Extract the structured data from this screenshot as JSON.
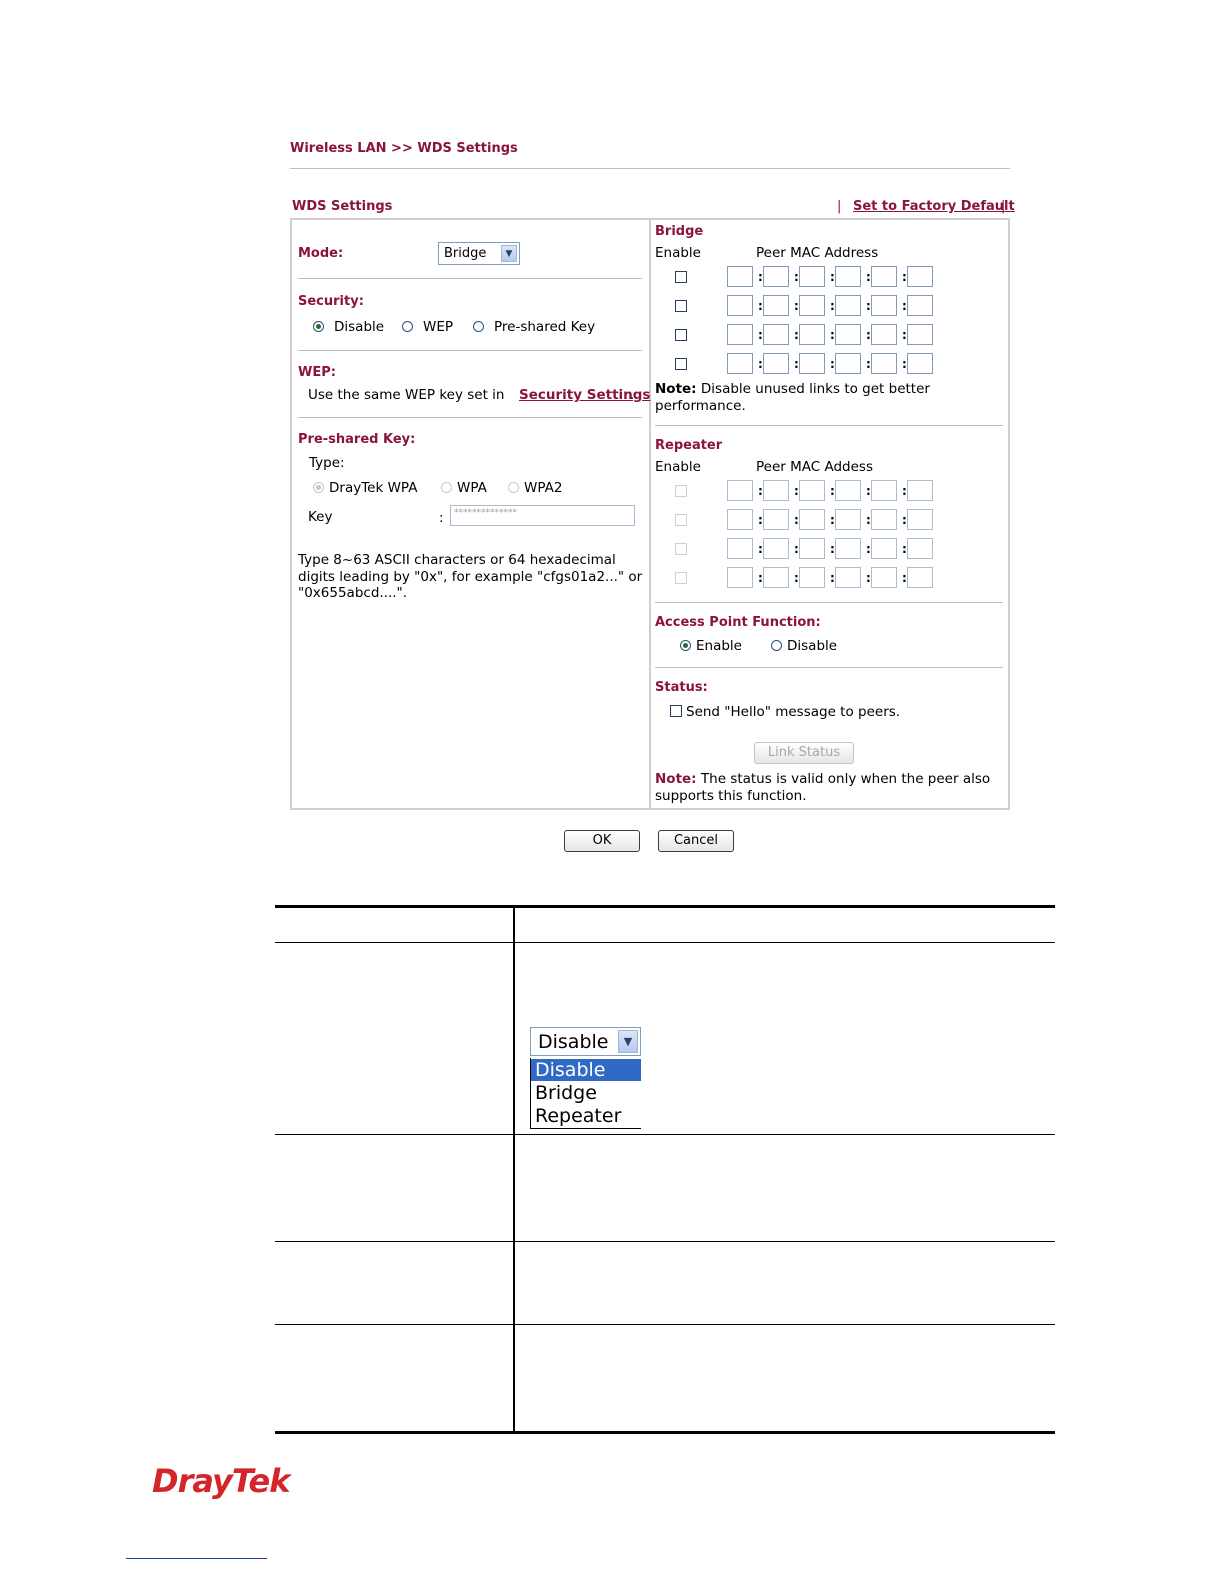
{
  "breadcrumb": "Wireless LAN >> WDS Settings",
  "panel": {
    "title": "WDS Settings",
    "factory_default": "Set to Factory Default",
    "sep_left": "|",
    "sep_right": "|"
  },
  "mode": {
    "label": "Mode:",
    "value": "Bridge"
  },
  "security": {
    "label": "Security:",
    "options": [
      "Disable",
      "WEP",
      "Pre-shared Key"
    ],
    "selected": "Disable"
  },
  "wep": {
    "label": "WEP:",
    "text": "Use the same WEP key set in",
    "link": "Security Settings",
    "trailing": "."
  },
  "psk": {
    "label": "Pre-shared Key:",
    "type_label": "Type:",
    "types": [
      "DrayTek WPA",
      "WPA",
      "WPA2"
    ],
    "key_label": "Key",
    "key_colon": ":",
    "key_value": "**************",
    "help_lines": [
      "Type 8~63 ASCII characters or 64 hexadecimal",
      "digits leading by \"0x\", for example \"cfgs01a2...\" or",
      "\"0x655abcd....\"."
    ]
  },
  "bridge": {
    "label": "Bridge",
    "col_enable": "Enable",
    "col_mac": "Peer MAC Address",
    "note_label": "Note:",
    "note_lines": [
      "Disable unused links to get better",
      "performance."
    ]
  },
  "repeater": {
    "label": "Repeater",
    "col_enable": "Enable",
    "col_mac": "Peer MAC Addess"
  },
  "ap_function": {
    "label": "Access Point Function:",
    "options": [
      "Enable",
      "Disable"
    ],
    "selected": "Enable"
  },
  "status": {
    "label": "Status:",
    "hello": "Send \"Hello\" message to peers.",
    "link_status": "Link Status",
    "note_label": "Note:",
    "note_lines": [
      "The status is valid only when the peer also",
      "supports this function."
    ]
  },
  "buttons": {
    "ok": "OK",
    "cancel": "Cancel"
  },
  "dropdown_demo": {
    "value": "Disable",
    "options": [
      "Disable",
      "Bridge",
      "Repeater"
    ],
    "highlighted": "Disable"
  },
  "footer": {
    "logo": "DrayTek"
  }
}
